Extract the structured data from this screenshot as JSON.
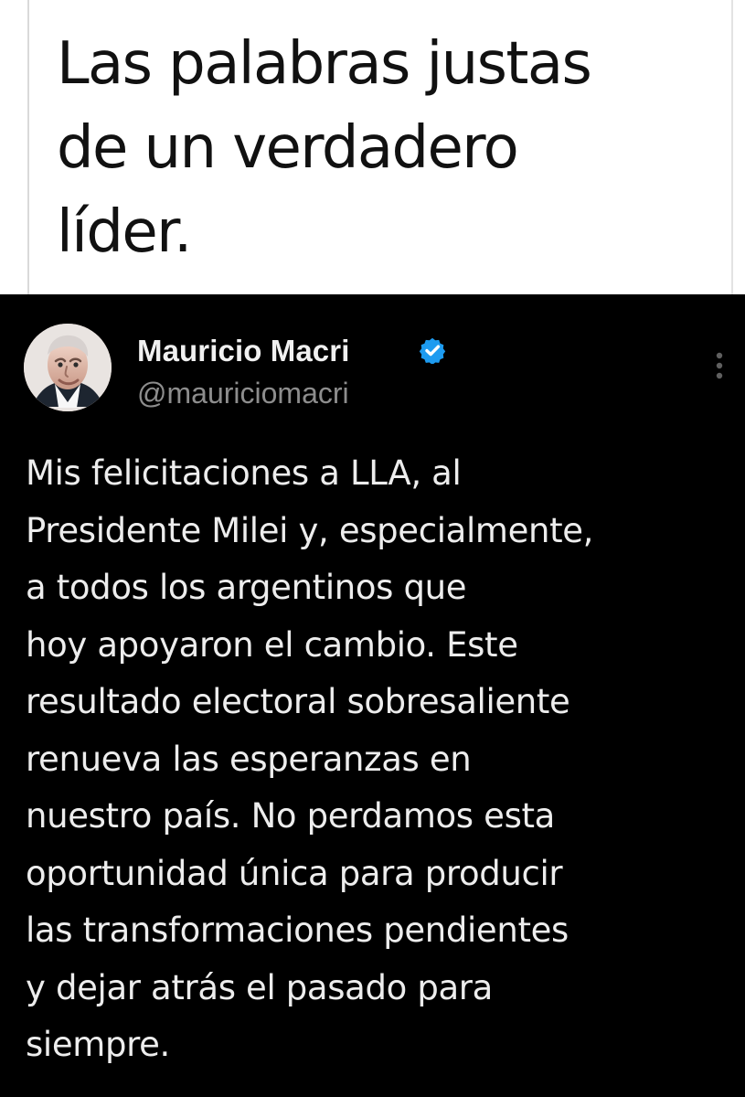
{
  "caption": {
    "lines": [
      "Las palabras justas",
      "de un verdadero",
      "líder."
    ]
  },
  "tweet": {
    "display_name": "Mauricio Macri",
    "handle": "@mauriciomacri",
    "verified_icon": "verified-badge-icon",
    "avatar_icon": "profile-photo",
    "more_icon": "vertical-ellipsis-icon",
    "lines": [
      "Mis felicitaciones a LLA, al",
      "Presidente Milei y, especialmente,",
      "a todos los argentinos que",
      "hoy apoyaron el cambio. Este",
      "resultado electoral sobresaliente",
      "renueva las esperanzas en",
      "nuestro país. No perdamos esta",
      "oportunidad única para producir",
      "las transformaciones pendientes",
      "y dejar atrás el pasado para",
      "siempre."
    ]
  },
  "colors": {
    "caption_background": "#ffffff",
    "caption_text": "#111111",
    "tweet_background": "#000000",
    "tweet_text": "#ededed",
    "handle_text": "#8d8d8d",
    "verified_badge": "#1d9bf0"
  }
}
